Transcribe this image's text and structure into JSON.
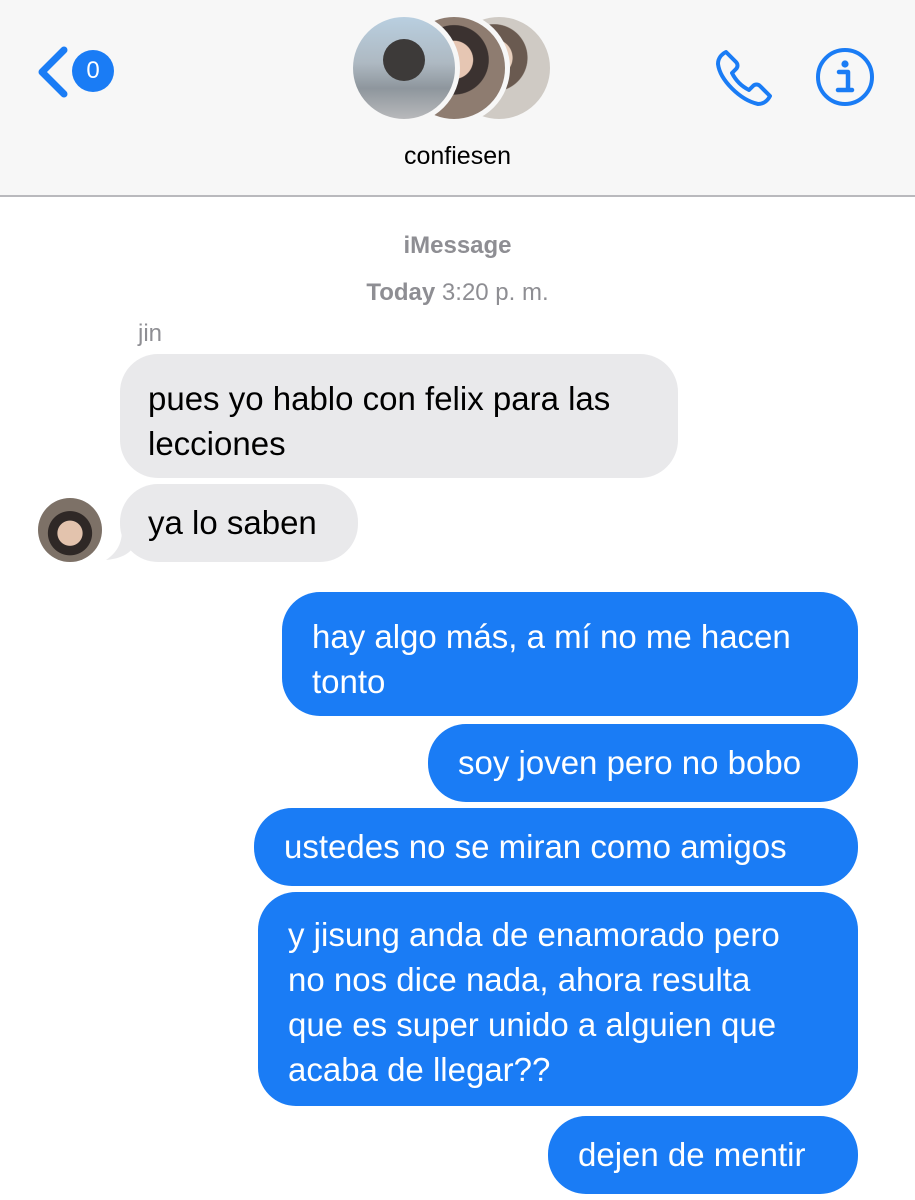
{
  "header": {
    "back_badge": "0",
    "group_name": "confiesen"
  },
  "thread": {
    "service": "iMessage",
    "day": "Today",
    "time": "3:20 p. m.",
    "sender": "jin"
  },
  "messages_in": [
    "pues yo hablo con felix para las\nlecciones",
    "ya lo saben"
  ],
  "messages_out": [
    "hay algo más, a mí no me hacen\ntonto",
    "soy joven pero no bobo",
    "ustedes no se miran como amigos",
    "y jisung anda de enamorado pero\nno nos dice nada, ahora resulta\nque es super unido a alguien que\nacaba de llegar??",
    "dejen de mentir"
  ],
  "colors": {
    "accent": "#1a7cf5",
    "incoming_bubble": "#e9e9eb",
    "header_bg": "#f7f7f7",
    "meta_text": "#8e8e93"
  },
  "icons": {
    "back": "chevron-left-icon",
    "phone": "phone-icon",
    "info": "info-icon"
  }
}
